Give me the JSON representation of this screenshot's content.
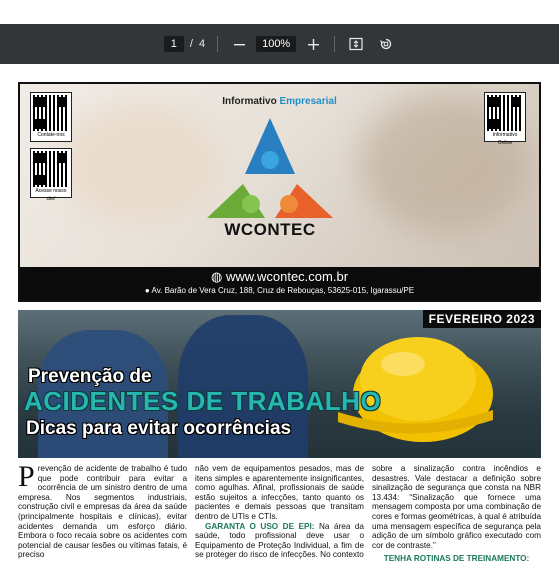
{
  "toolbar": {
    "page_current": "1",
    "page_separator": "/",
    "page_total": "4",
    "zoom_out_icon": "minus-icon",
    "zoom_level": "100%",
    "zoom_in_icon": "plus-icon",
    "fit_icon": "fit-page-icon",
    "rotate_icon": "rotate-icon"
  },
  "banner": {
    "title_prefix": "Informativo",
    "title_accent": "Empresarial",
    "brand": "WCONTEC",
    "qr_left_top_caption": "Contate-nos",
    "qr_left_bottom_caption": "Acesse nosso site!",
    "qr_right_caption": "Informativo Online",
    "website": "www.wcontec.com.br",
    "address": "Av. Barão de Vera Cruz, 188, Cruz de Rebouças, 53625-015, Igarassu/PE",
    "colors": {
      "blue": "#2a7fc1",
      "green": "#6cab3a",
      "orange": "#e8602a"
    }
  },
  "article": {
    "edition": "FEVEREIRO 2023",
    "title_line1": "Prevenção de",
    "title_line2": "ACIDENTES DE TRABALHO",
    "title_line3": "Dicas para evitar ocorrências",
    "col1_dropcap": "P",
    "col1_text": "revenção de acidente de trabalho é tudo que pode contribuir para evitar a ocorrência de um sinistro dentro de uma empresa. Nos segmentos industriais, construção civil e empresas da área da saúde (principalmente hospitais e clínicas), evitar acidentes demanda um esforço diário. Embora o foco recaia sobre os acidentes com potencial de causar lesões ou vítimas fatais, é preciso",
    "col2_text1": "não vem de equipamentos pesados, mas de itens simples e aparentemente insignificantes, como agulhas. Afinal, profissionais de saúde estão sujeitos a infecções, tanto quanto os pacientes e demais pessoas que transitam dentro de UTIs e CTIs.",
    "col2_subhead": "GARANTA O USO DE EPI:",
    "col2_text2": "Na área da saúde, todo profissional deve usar o Equipamento de Proteção Individual, a fim de se proteger do risco de infecções. No contexto",
    "col3_text1": "sobre a sinalização contra incêndios e desastres. Vale destacar a definição sobre sinalização de segurança que consta na NBR 13.434: “Sinalização que fornece uma mensagem composta por uma combinação de cores e formas geométricas, à qual é atribuída uma mensagem específica de segurança pela adição de um símbolo gráfico executado com cor de contraste.”",
    "col3_subhead": "TENHA ROTINAS DE TREINAMENTO:"
  }
}
